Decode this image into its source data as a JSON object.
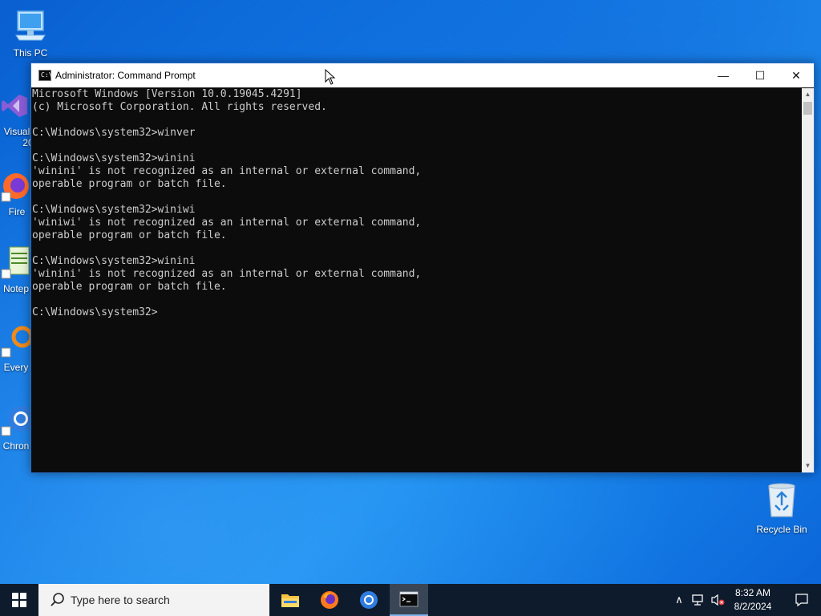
{
  "desktop": {
    "icons": [
      {
        "label": "This PC"
      },
      {
        "label": "Visual"
      },
      {
        "label": "20"
      },
      {
        "label": "Fire"
      },
      {
        "label": "Notep"
      },
      {
        "label": "Every"
      },
      {
        "label": "Chron"
      },
      {
        "label": "Recycle Bin"
      }
    ]
  },
  "window": {
    "title": "Administrator: Command Prompt",
    "title_icon_text": "C:\\",
    "controls": {
      "minimize": "—",
      "maximize": "☐",
      "close": "✕"
    }
  },
  "console": {
    "lines": [
      "Microsoft Windows [Version 10.0.19045.4291]",
      "(c) Microsoft Corporation. All rights reserved.",
      "",
      "C:\\Windows\\system32>winver",
      "",
      "C:\\Windows\\system32>winini",
      "'winini' is not recognized as an internal or external command,",
      "operable program or batch file.",
      "",
      "C:\\Windows\\system32>winiwi",
      "'winiwi' is not recognized as an internal or external command,",
      "operable program or batch file.",
      "",
      "C:\\Windows\\system32>winini",
      "'winini' is not recognized as an internal or external command,",
      "operable program or batch file.",
      "",
      "C:\\Windows\\system32>"
    ]
  },
  "taskbar": {
    "search_placeholder": "Type here to search",
    "apps": [
      {
        "name": "file-explorer-icon"
      },
      {
        "name": "firefox-icon"
      },
      {
        "name": "chrome-icon"
      },
      {
        "name": "command-prompt-icon",
        "active": true
      }
    ],
    "clock_time": "8:32 AM",
    "clock_date": "8/2/2024"
  },
  "colors": {
    "console_bg": "#0c0c0c",
    "console_fg": "#cccccc",
    "taskbar_bg": "#0e1b2c",
    "desktop_blue": "#0f7ae5"
  }
}
